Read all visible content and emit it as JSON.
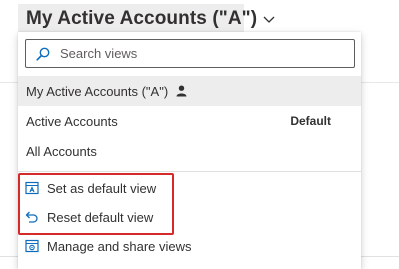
{
  "view_selector": {
    "title": "My Active Accounts (\"A\")"
  },
  "search": {
    "placeholder": "Search views"
  },
  "views": [
    {
      "label": "My Active Accounts (\"A\")",
      "selected": true,
      "badge": ""
    },
    {
      "label": "Active Accounts",
      "selected": false,
      "badge": "Default"
    },
    {
      "label": "All Accounts",
      "selected": false,
      "badge": ""
    }
  ],
  "actions": {
    "set_default": "Set as default view",
    "reset_default": "Reset default view",
    "manage_share": "Manage and share views"
  },
  "colors": {
    "accent": "#0f6cbd",
    "highlight": "#d52a2a",
    "selected_bg": "#ededed"
  }
}
